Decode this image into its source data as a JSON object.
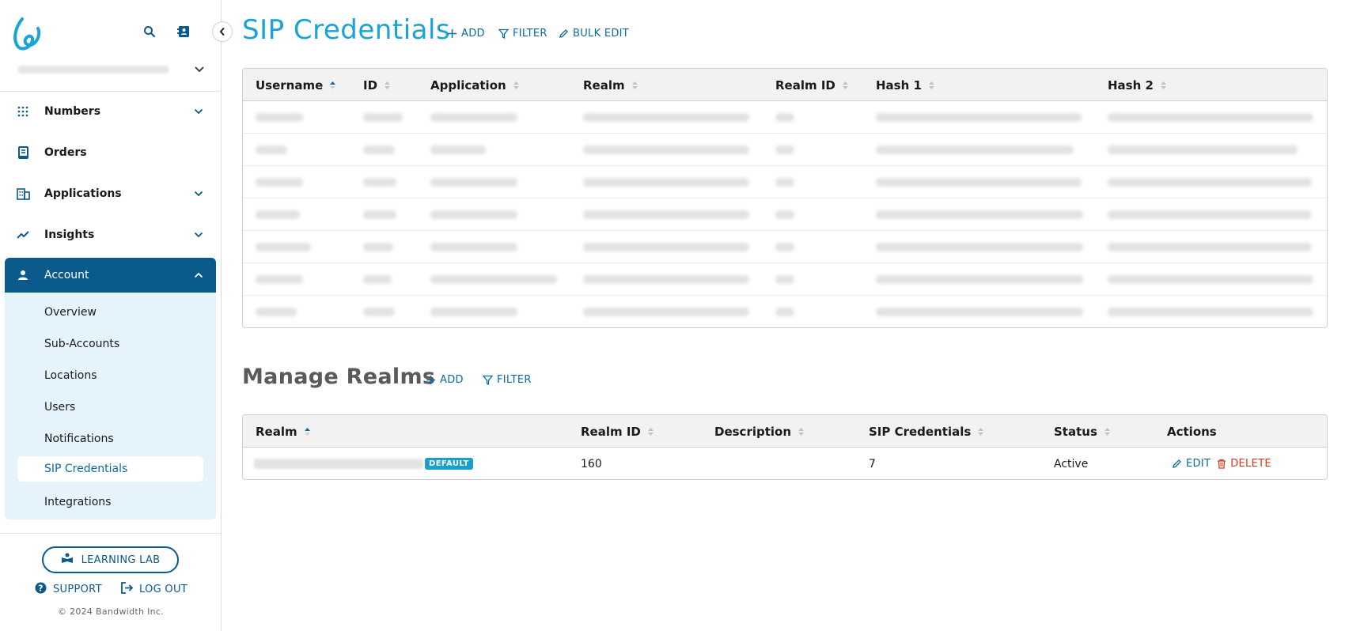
{
  "sidebar": {
    "nav": [
      {
        "label": "Numbers",
        "icon": "grid-dots-icon",
        "expanded": false
      },
      {
        "label": "Orders",
        "icon": "book-icon"
      },
      {
        "label": "Applications",
        "icon": "buildings-icon",
        "expanded": false
      },
      {
        "label": "Insights",
        "icon": "trend-icon",
        "expanded": false
      },
      {
        "label": "Account",
        "icon": "person-icon",
        "expanded": true
      }
    ],
    "account_sub": [
      {
        "label": "Overview"
      },
      {
        "label": "Sub-Accounts"
      },
      {
        "label": "Locations"
      },
      {
        "label": "Users"
      },
      {
        "label": "Notifications"
      },
      {
        "label": "SIP Credentials",
        "selected": true
      },
      {
        "label": "Integrations"
      }
    ],
    "learning_lab": "LEARNING LAB",
    "support": "SUPPORT",
    "logout": "LOG OUT",
    "copyright": "© 2024 Bandwidth Inc."
  },
  "sip_credentials": {
    "title": "SIP Credentials",
    "actions": {
      "add": "ADD",
      "filter": "FILTER",
      "bulk_edit": "BULK EDIT"
    },
    "columns": [
      "Username",
      "ID",
      "Application",
      "Realm",
      "Realm ID",
      "Hash 1",
      "Hash 2"
    ]
  },
  "manage_realms": {
    "title": "Manage Realms",
    "actions": {
      "add": "ADD",
      "filter": "FILTER"
    },
    "columns": [
      "Realm",
      "Realm ID",
      "Description",
      "SIP Credentials",
      "Status",
      "Actions"
    ],
    "row": {
      "badge": "DEFAULT",
      "realm_id": "160",
      "description": "",
      "sip_credentials": "7",
      "status": "Active",
      "edit": "EDIT",
      "delete": "DELETE"
    }
  },
  "colors": {
    "accent": "#19a3d6",
    "nav_active": "#0a5a8c",
    "sub_panel": "#e4f3fc",
    "danger": "#d13a1e"
  }
}
